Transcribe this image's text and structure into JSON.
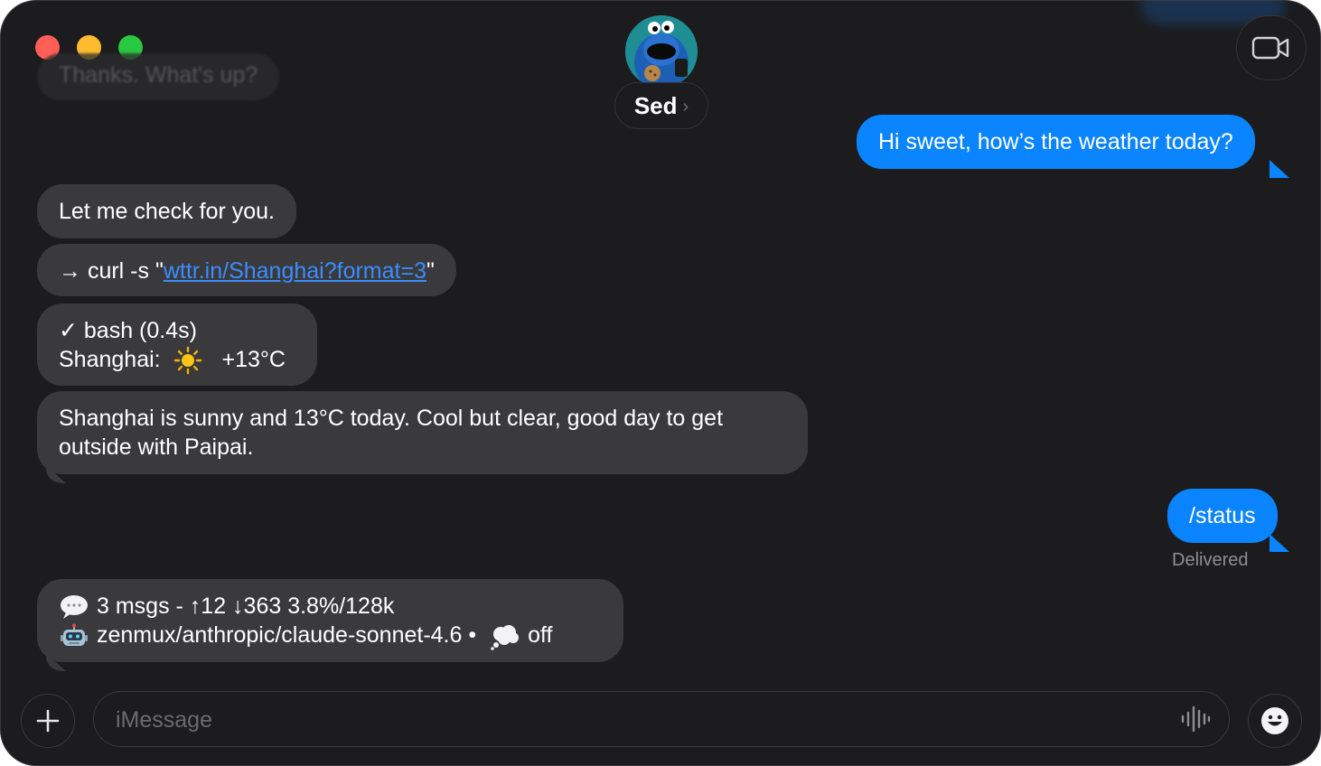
{
  "contact": {
    "name": "Sed"
  },
  "messages": {
    "faded_preview": "Thanks. What's up?",
    "user_weather": "Hi sweet, how’s the weather today?",
    "reply_check": "Let me check for you.",
    "cmd_prefix": "→ curl -s \"",
    "cmd_link": "wttr.in/Shanghai?format=3",
    "cmd_suffix": "\"",
    "bash_result": "✓ bash (0.4s)",
    "shanghai_label": "Shanghai:",
    "shanghai_temp": "+13°C",
    "summary": "Shanghai is sunny and 13°C today. Cool but clear, good day to get outside with Paipai.",
    "user_status": "/status",
    "status_line1": "3 msgs - ↑12 ↓363 3.8%/128k",
    "status_line2_model": "zenmux/anthropic/claude-sonnet-4.6 •",
    "status_line2_off": "off"
  },
  "status": {
    "delivered": "Delivered"
  },
  "compose": {
    "placeholder": "iMessage"
  },
  "colors": {
    "window_bg": "#1c1c1e",
    "incoming_bubble": "#3a3a3c",
    "outgoing_bubble": "#0a84ff",
    "link": "#3b8cff"
  }
}
